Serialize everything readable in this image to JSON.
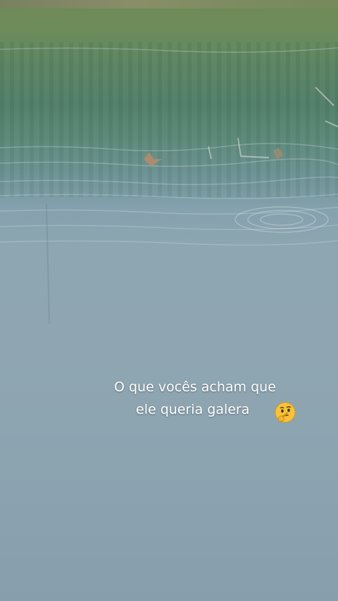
{
  "story": {
    "caption_line_1": "O que vocês acham que",
    "caption_line_2": "ele queria galera",
    "emoji_icon": "thinking-face-icon"
  },
  "colors": {
    "water_top": "#5e8a7c",
    "water_bottom": "#879fad",
    "caption_text": "#ffffff",
    "emoji_yellow": "#f6c33b"
  }
}
